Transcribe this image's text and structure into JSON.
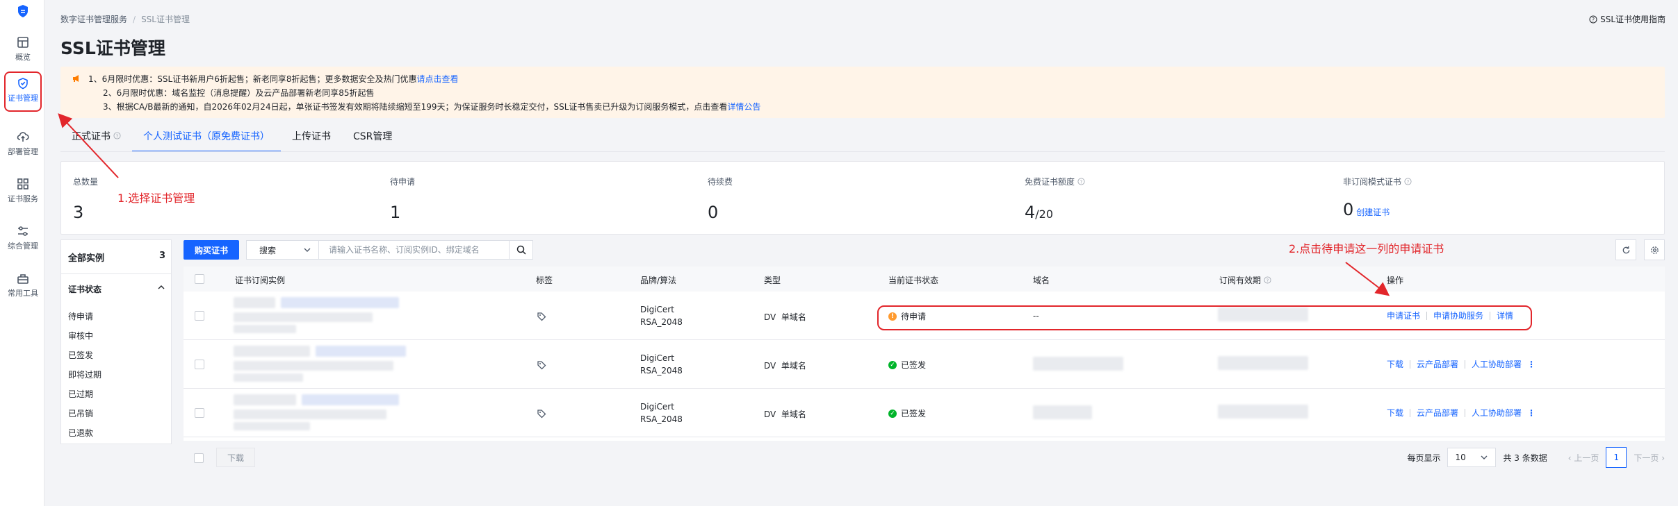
{
  "rail": {
    "items": [
      {
        "label": "概览",
        "icon": "layout-icon"
      },
      {
        "label": "证书管理",
        "icon": "shield-icon"
      },
      {
        "label": "部署管理",
        "icon": "cloud-upload-icon"
      },
      {
        "label": "证书服务",
        "icon": "grid-icon"
      },
      {
        "label": "综合管理",
        "icon": "sliders-icon"
      },
      {
        "label": "常用工具",
        "icon": "toolbox-icon"
      }
    ]
  },
  "header": {
    "breadcrumb": [
      "数字证书管理服务",
      "SSL证书管理"
    ],
    "guide": "SSL证书使用指南",
    "title": "SSL证书管理"
  },
  "notice": {
    "line1": "1、6月限时优惠：SSL证书新用户6折起售；新老同享8折起售；更多数据安全及热门优惠",
    "line1_link": "请点击查看",
    "line2": "2、6月限时优惠：域名监控（消息提醒）及云产品部署新老同享85折起售",
    "line3": "3、根据CA/B最新的通知，自2026年02月24日起，单张证书签发有效期将陆续缩短至199天；为保证服务时长稳定交付，SSL证书售卖已升级为订阅服务模式，点击查看",
    "line3_link": "详情公告"
  },
  "tabs": [
    {
      "label": "正式证书",
      "active": false
    },
    {
      "label": "个人测试证书（原免费证书）",
      "active": true
    },
    {
      "label": "上传证书",
      "active": false
    },
    {
      "label": "CSR管理",
      "active": false
    }
  ],
  "stats": {
    "total": {
      "label": "总数量",
      "value": "3"
    },
    "pending": {
      "label": "待申请",
      "value": "1"
    },
    "renew": {
      "label": "待续费",
      "value": "0"
    },
    "quota": {
      "label": "免费证书额度",
      "value": "4",
      "total": "/20"
    },
    "non_sub": {
      "label": "非订阅模式证书",
      "value": "0",
      "link": "创建证书"
    }
  },
  "filter": {
    "all_label": "全部实例",
    "all_count": "3",
    "group_label": "证书状态",
    "options": [
      "待申请",
      "审核中",
      "已签发",
      "即将过期",
      "已过期",
      "已吊销",
      "已退款"
    ]
  },
  "toolbar": {
    "buy_label": "购买证书",
    "search_select": "搜索",
    "search_placeholder": "请输入证书名称、订阅实例ID、绑定域名"
  },
  "table": {
    "columns": [
      "证书订阅实例",
      "标签",
      "品牌/算法",
      "类型",
      "当前证书状态",
      "域名",
      "订阅有效期",
      "操作"
    ],
    "rows": [
      {
        "brand": "DigiCert",
        "algo": "RSA_2048",
        "type": "DV  单域名",
        "status": "待申请",
        "status_kind": "warn",
        "domain": "--",
        "actions": [
          "申请证书",
          "申请协助服务",
          "详情"
        ]
      },
      {
        "brand": "DigiCert",
        "algo": "RSA_2048",
        "type": "DV  单域名",
        "status": "已签发",
        "status_kind": "ok",
        "domain": "",
        "actions": [
          "下载",
          "云产品部署",
          "人工协助部署"
        ]
      },
      {
        "brand": "DigiCert",
        "algo": "RSA_2048",
        "type": "DV  单域名",
        "status": "已签发",
        "status_kind": "ok",
        "domain": "",
        "actions": [
          "下载",
          "云产品部署",
          "人工协助部署"
        ]
      }
    ]
  },
  "annotations": {
    "step1": "1.选择证书管理",
    "step2": "2.点击待申请这一列的申请证书"
  },
  "footer": {
    "download_label": "下载",
    "per_page_label": "每页显示",
    "per_page_value": "10",
    "total_text": "共 3 条数据",
    "prev": "上一页",
    "page": "1",
    "next": "下一页"
  },
  "colors": {
    "primary": "#1664ff",
    "annotation": "#e2262b",
    "notice_bg": "#fff4e8",
    "ok": "#00b42a",
    "warn": "#ff9a2e"
  }
}
